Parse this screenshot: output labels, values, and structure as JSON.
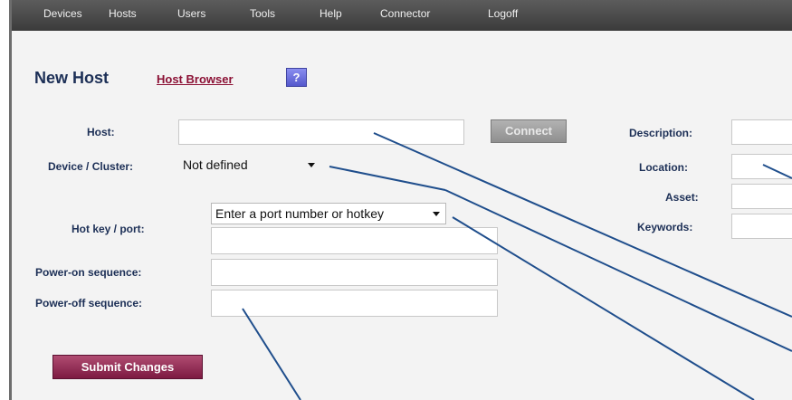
{
  "menu": [
    "Devices",
    "Hosts",
    "Users",
    "Tools",
    "Help",
    "Connector",
    "Logoff"
  ],
  "header": {
    "title": "New Host",
    "browser_link": "Host Browser",
    "help_label": "?"
  },
  "form": {
    "host_label": "Host:",
    "host_value": "",
    "connect_label": "Connect",
    "device_label": "Device / Cluster:",
    "device_value": "Not defined",
    "hotkey_label": "Hot key / port:",
    "hotkey_select": "Enter a port number or hotkey",
    "hotkey_value": "",
    "poweron_label": "Power-on sequence:",
    "poweron_value": "",
    "poweroff_label": "Power-off sequence:",
    "poweroff_value": "",
    "description_label": "Description:",
    "location_label": "Location:",
    "asset_label": "Asset:",
    "keywords_label": "Keywords:",
    "submit_label": "Submit Changes"
  },
  "colors": {
    "accent": "#8b1034",
    "label": "#1c2f56",
    "callout": "#1f4e8c"
  }
}
